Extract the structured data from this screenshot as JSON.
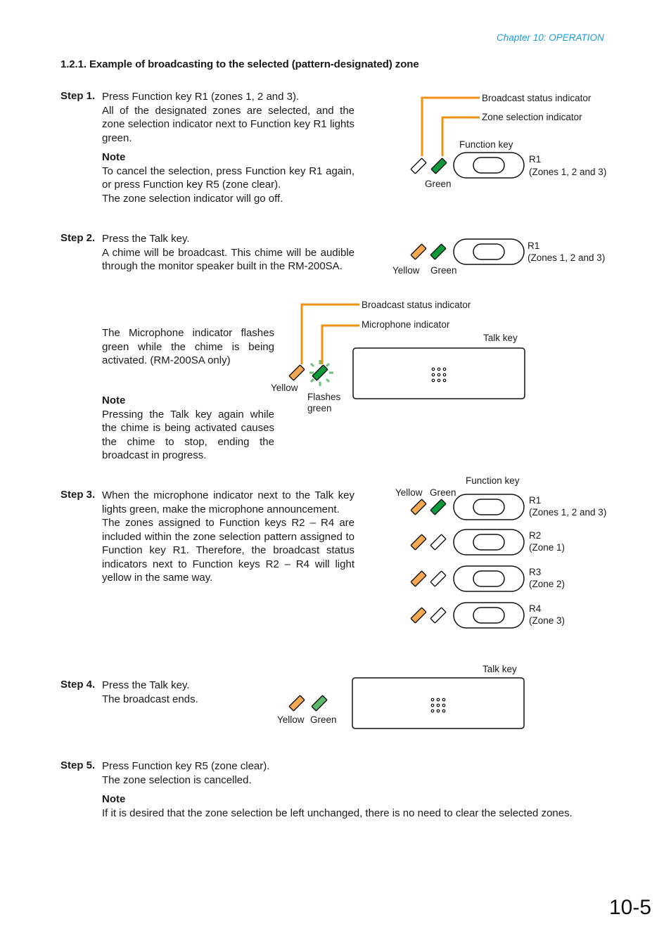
{
  "header": {
    "chapter": "Chapter 10: OPERATION"
  },
  "section": {
    "title": "1.2.1. Example of broadcasting to the selected (pattern-designated) zone"
  },
  "colors": {
    "accent_blue": "#1a9cd6",
    "leader_orange": "#f29111",
    "indicator_yellow": "#f7a851",
    "indicator_green": "#0d9a3b",
    "indicator_green_light": "#5cb96a",
    "flash_green": "#6ac27a"
  },
  "steps": [
    {
      "label": "Step 1.",
      "lines": [
        "Press Function key R1 (zones 1, 2 and 3).",
        "All of the designated zones are selected, and the zone selection indicator next to Function key R1 lights green."
      ],
      "note_title": "Note",
      "note_lines": [
        "To cancel the selection, press Function key R1 again, or press Function key R5 (zone clear).",
        "The zone selection indicator will go off."
      ]
    },
    {
      "label": "Step 2.",
      "lines": [
        "Press the Talk key.",
        "A chime will be broadcast. This chime will be audible through the monitor speaker built in the RM-200SA."
      ],
      "sub_text": "The Microphone indicator flashes green while the chime is being activated. (RM-200SA only)",
      "note_title": "Note",
      "note_text": "Pressing the Talk key again while the chime is being activated causes the chime to stop, ending the broadcast in progress."
    },
    {
      "label": "Step 3.",
      "lines": [
        "When the microphone indicator next to the Talk key lights green, make the microphone announcement.",
        "The zones assigned to Function keys R2 – R4 are included within the zone selection pattern assigned to Function key R1. Therefore, the broadcast status indicators next to Function keys R2 – R4 will light yellow in the same way."
      ]
    },
    {
      "label": "Step 4.",
      "lines": [
        "Press the Talk key.",
        "The broadcast ends."
      ]
    },
    {
      "label": "Step 5.",
      "lines": [
        "Press Function key R5 (zone clear).",
        "The zone selection is cancelled."
      ],
      "note_title": "Note",
      "note_text": "If it is desired that the zone selection be left unchanged, there is no need to clear the selected zones."
    }
  ],
  "diagrams": {
    "d1": {
      "callout_broadcast": "Broadcast status indicator",
      "callout_zone": "Zone selection indicator",
      "function_key_label": "Function key",
      "key_name": "R1",
      "key_zones": "(Zones 1, 2 and 3)",
      "left_indicator": "off",
      "right_indicator": "green",
      "color_label": "Green"
    },
    "d2": {
      "key_name": "R1",
      "key_zones": "(Zones 1, 2 and 3)",
      "yellow_label": "Yellow",
      "green_label": "Green"
    },
    "d2b": {
      "callout_broadcast": "Broadcast status indicator",
      "callout_mic": "Microphone indicator",
      "talk_key_label": "Talk key",
      "yellow_label": "Yellow",
      "flash_label_1": "Flashes",
      "flash_label_2": "green"
    },
    "d3": {
      "function_key_label": "Function key",
      "yellow_label": "Yellow",
      "green_label": "Green",
      "keys": [
        {
          "name": "R1",
          "zones": "(Zones 1, 2 and 3)",
          "left": "yellow",
          "right": "green"
        },
        {
          "name": "R2",
          "zones": "(Zone 1)",
          "left": "yellow",
          "right": "off"
        },
        {
          "name": "R3",
          "zones": "(Zone 2)",
          "left": "yellow",
          "right": "off"
        },
        {
          "name": "R4",
          "zones": "(Zone 3)",
          "left": "yellow",
          "right": "off"
        }
      ]
    },
    "d4": {
      "talk_key_label": "Talk key",
      "yellow_label": "Yellow",
      "green_label": "Green"
    }
  },
  "footer": {
    "page_number": "10-5"
  }
}
